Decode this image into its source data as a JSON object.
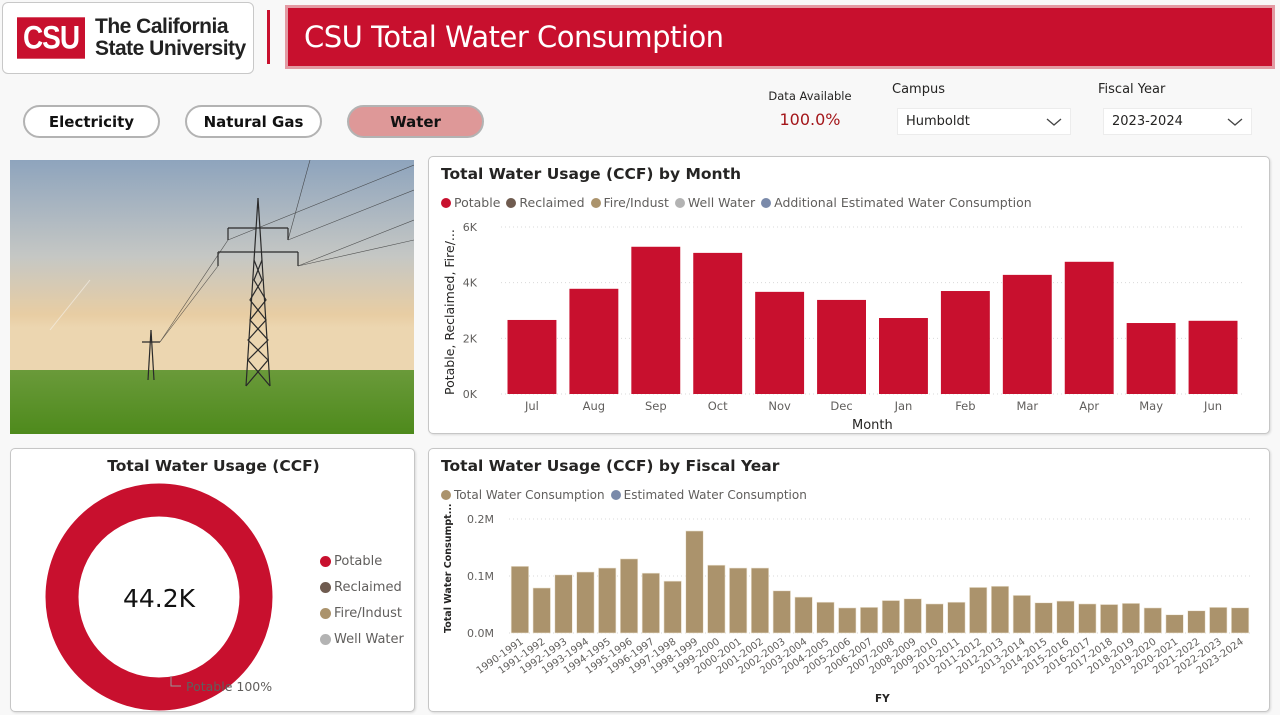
{
  "logo": {
    "mark": "CSU",
    "line1": "The California",
    "line2": "State University"
  },
  "header": {
    "title": "CSU Total Water Consumption"
  },
  "nav": {
    "buttons": [
      {
        "label": "Electricity",
        "active": false
      },
      {
        "label": "Natural Gas",
        "active": false
      },
      {
        "label": "Water",
        "active": true
      }
    ]
  },
  "data_available": {
    "label": "Data Available",
    "value": "100.0%"
  },
  "filters": {
    "campus": {
      "label": "Campus",
      "value": "Humboldt"
    },
    "fiscal_year": {
      "label": "Fiscal Year",
      "value": "2023-2024"
    }
  },
  "photo": {
    "description": "power-lines-field-photo"
  },
  "colors": {
    "potable": "#c8102e",
    "reclaimed": "#6f5b4f",
    "fire_indust": "#ab936c",
    "well_water": "#b3b3b3",
    "estimated": "#7a8aaa",
    "brand_red": "#c8102e"
  },
  "chart_data": [
    {
      "id": "monthly",
      "type": "bar",
      "title": "Total Water Usage (CCF) by Month",
      "xlabel": "Month",
      "ylabel": "Potable, Reclaimed, Fire/...",
      "legend": [
        "Potable",
        "Reclaimed",
        "Fire/Indust",
        "Well Water",
        "Additional Estimated Water Consumption"
      ],
      "legend_placement": "top-left",
      "categories": [
        "Jul",
        "Aug",
        "Sep",
        "Oct",
        "Nov",
        "Dec",
        "Jan",
        "Feb",
        "Mar",
        "Apr",
        "May",
        "Jun"
      ],
      "series": [
        {
          "name": "Potable",
          "values": [
            2660,
            3780,
            5290,
            5070,
            3670,
            3380,
            2730,
            3700,
            4280,
            4750,
            2550,
            2630
          ]
        }
      ],
      "yticks": [
        0,
        2000,
        4000,
        6000
      ],
      "ytick_labels": [
        "0K",
        "2K",
        "4K",
        "6K"
      ],
      "ylim": [
        0,
        6000
      ],
      "grid": true
    },
    {
      "id": "donut",
      "type": "pie",
      "title": "Total Water Usage (CCF)",
      "center_label": "44.2K",
      "legend": [
        "Potable",
        "Reclaimed",
        "Fire/Indust",
        "Well Water"
      ],
      "legend_placement": "right",
      "slices": [
        {
          "name": "Potable",
          "value": 44200,
          "percent": 100
        }
      ],
      "data_label": "Potable 100%"
    },
    {
      "id": "fiscal",
      "type": "bar",
      "title": "Total Water Usage (CCF) by Fiscal Year",
      "xlabel": "FY",
      "ylabel": "Total Water Consumpt...",
      "legend": [
        "Total Water Consumption",
        "Estimated Water Consumption"
      ],
      "legend_placement": "top-left",
      "categories": [
        "1990-1991",
        "1991-1992",
        "1992-1993",
        "1993-1994",
        "1994-1995",
        "1995-1996",
        "1996-1997",
        "1997-1998",
        "1998-1999",
        "1999-2000",
        "2000-2001",
        "2001-2002",
        "2002-2003",
        "2003-2004",
        "2004-2005",
        "2005-2006",
        "2006-2007",
        "2007-2008",
        "2008-2009",
        "2009-2010",
        "2010-2011",
        "2011-2012",
        "2012-2013",
        "2013-2014",
        "2014-2015",
        "2015-2016",
        "2016-2017",
        "2017-2018",
        "2018-2019",
        "2019-2020",
        "2020-2021",
        "2021-2022",
        "2022-2023",
        "2023-2024"
      ],
      "series": [
        {
          "name": "Total Water Consumption",
          "values": [
            117000,
            79000,
            102000,
            107000,
            114000,
            130000,
            105000,
            91000,
            179000,
            119000,
            114000,
            114000,
            74000,
            63000,
            54000,
            44000,
            45000,
            57000,
            60000,
            51000,
            54000,
            80000,
            82000,
            66000,
            53000,
            56000,
            51000,
            50000,
            52000,
            44000,
            32000,
            39000,
            45000,
            44200
          ]
        }
      ],
      "yticks": [
        0,
        100000,
        200000
      ],
      "ytick_labels": [
        "0.0M",
        "0.1M",
        "0.2M"
      ],
      "ylim": [
        0,
        200000
      ],
      "grid": true
    }
  ]
}
